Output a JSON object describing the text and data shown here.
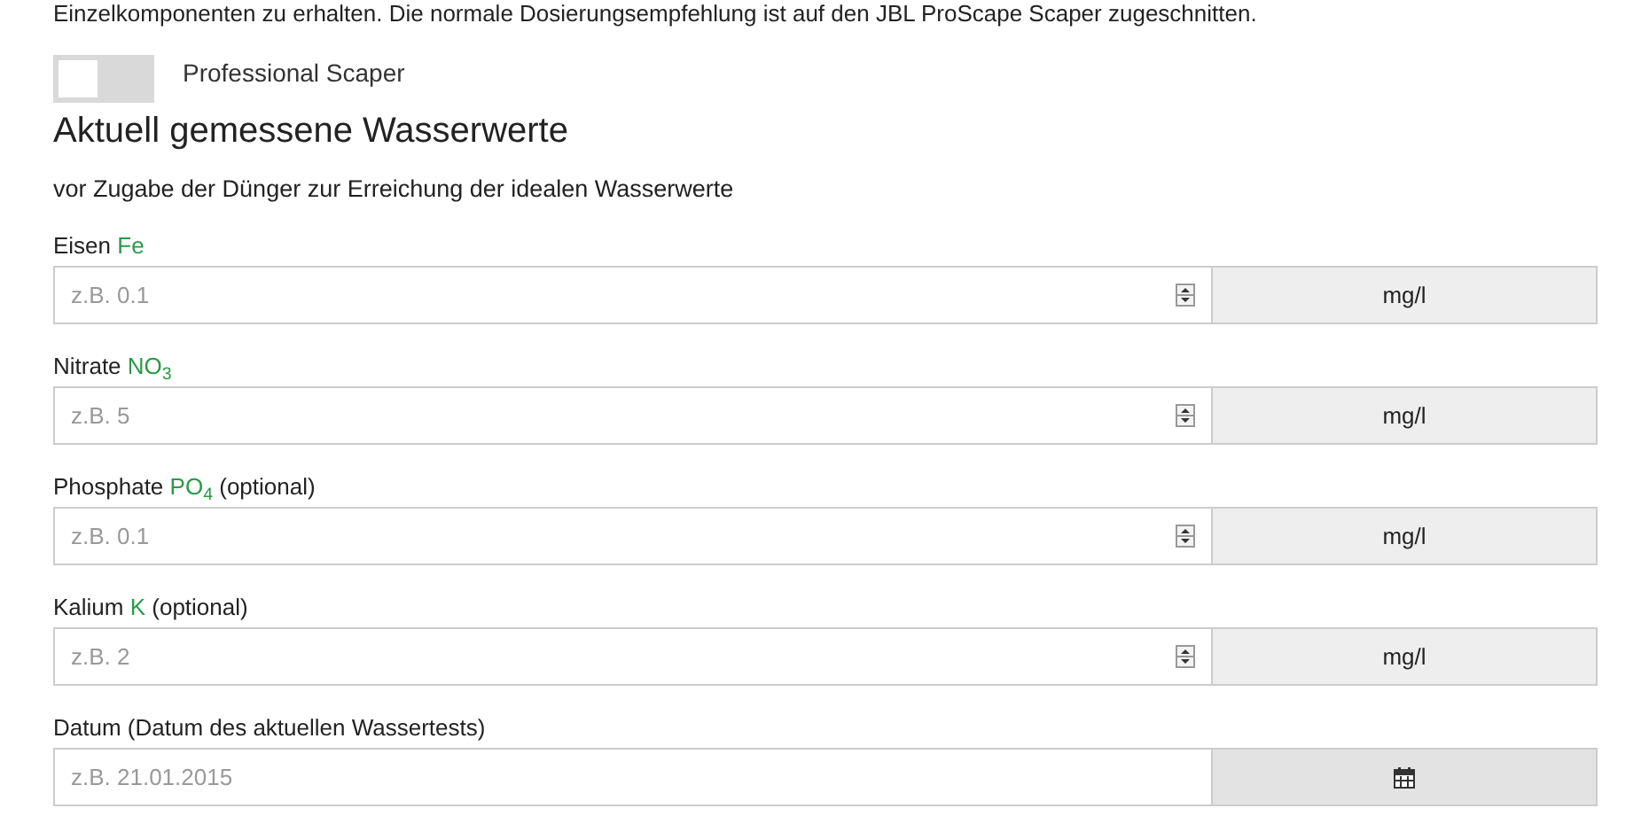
{
  "intro_text": "Einzelkomponenten zu erhalten. Die normale Dosierungsempfehlung ist auf den JBL ProScape Scaper zugeschnitten.",
  "toggle": {
    "label": "Professional Scaper",
    "on": false
  },
  "heading": "Aktuell gemessene Wasserwerte",
  "subtitle": "vor Zugabe der Dünger zur Erreichung der idealen Wasserwerte",
  "fields": [
    {
      "kind": "number",
      "label": "Eisen",
      "formula": "Fe",
      "placeholder": "z.B. 0.1",
      "addon": "mg/l"
    },
    {
      "kind": "number",
      "label": "Nitrate",
      "formula": "NO$_{3}$",
      "placeholder": "z.B. 5",
      "addon": "mg/l"
    },
    {
      "kind": "number",
      "label": "Phosphate",
      "formula": "PO$_{4}$",
      "note": "(optional)",
      "placeholder": "z.B. 0.1",
      "addon": "mg/l"
    },
    {
      "kind": "number",
      "label": "Kalium",
      "formula": "K",
      "note": "(optional)",
      "placeholder": "z.B. 2",
      "addon": "mg/l"
    },
    {
      "kind": "date",
      "label": "Datum (Datum des aktuellen Wassertests)",
      "placeholder": "z.B. 21.01.2015"
    }
  ]
}
